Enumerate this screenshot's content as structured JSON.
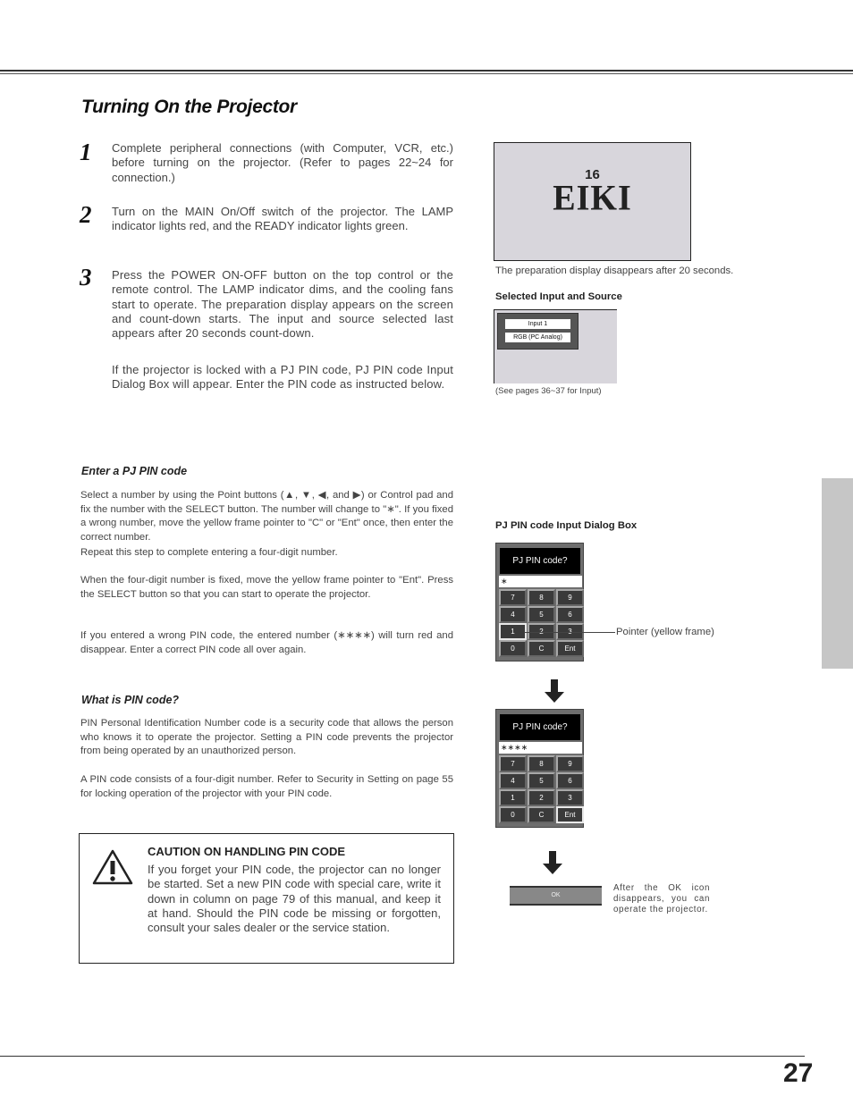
{
  "page": {
    "title": "Turning On the Projector",
    "page_number": "27"
  },
  "steps": [
    {
      "number": "1",
      "text": "Complete peripheral connections (with Computer, VCR, etc.) before turning on the projector. (Refer to pages 22~24 for connection.)"
    },
    {
      "number": "2",
      "text": "Turn on the MAIN On/Off switch of the projector. The LAMP indicator lights red, and the READY indicator lights green."
    },
    {
      "number": "3",
      "text": "Press the POWER ON-OFF button on the top control or the remote control. The LAMP indicator dims, and the cooling fans start to operate. The preparation display appears on the screen and count-down starts. The input and source selected last appears after 20 seconds count-down.",
      "note": "If the projector is locked with a PJ PIN code, PJ PIN code Input Dialog Box will appear. Enter the PIN code as instructed below."
    }
  ],
  "preparation_display": {
    "countdown": "16",
    "logo": "EIKI",
    "caption": "The preparation display disappears after 20 seconds."
  },
  "selected_input": {
    "heading": "Selected Input and Source",
    "input": "Input 1",
    "source": "RGB (PC Analog)",
    "caption": "(See pages 36~37 for Input)"
  },
  "enter_pin": {
    "heading": "Enter a PJ PIN code",
    "paragraphs": [
      "Select a number by using the Point buttons (▲, ▼, ◀, and ▶) or Control pad and fix the number with the SELECT button. The number will change to \"∗\". If you fixed a wrong number, move the yellow frame pointer to \"C\" or \"Ent\" once, then enter the correct number.",
      "Repeat this step to complete entering a four-digit number.",
      "When the four-digit number is fixed, move the yellow frame pointer to \"Ent\". Press the SELECT button so that you can start to operate the projector.",
      "If you entered a wrong PIN code, the entered number (∗∗∗∗) will turn red and disappear. Enter a correct PIN code all over again."
    ]
  },
  "what_is_pin": {
    "heading": "What is PIN code?",
    "paragraphs": [
      "PIN Personal Identification Number code is a security code that allows the person who knows it to operate the projector. Setting a PIN code prevents the projector from being operated by an unauthorized person.",
      "A PIN code consists of a four-digit number. Refer to Security in Setting on page 55 for locking operation of the projector with your PIN code."
    ]
  },
  "pin_dialog": {
    "heading": "PJ PIN code Input Dialog Box",
    "title": "PJ PIN code?",
    "keys": [
      "7",
      "8",
      "9",
      "4",
      "5",
      "6",
      "1",
      "2",
      "3",
      "0",
      "C",
      "Ent"
    ],
    "first_state": {
      "value": "∗",
      "selected_key": "1"
    },
    "second_state": {
      "value": "∗∗∗∗",
      "selected_key": "Ent"
    },
    "pointer_label": "Pointer (yellow frame)"
  },
  "ok_step": {
    "ok_label": "OK",
    "caption": "After the OK icon disappears, you can operate the projector."
  },
  "caution": {
    "heading": "CAUTION ON HANDLING PIN CODE",
    "text": "If you forget your PIN code, the projector can no longer be started. Set a new PIN code with special care, write it down in column on page 79 of this manual, and keep it at hand. Should the PIN code be missing or forgotten, consult your sales dealer or the service station."
  }
}
